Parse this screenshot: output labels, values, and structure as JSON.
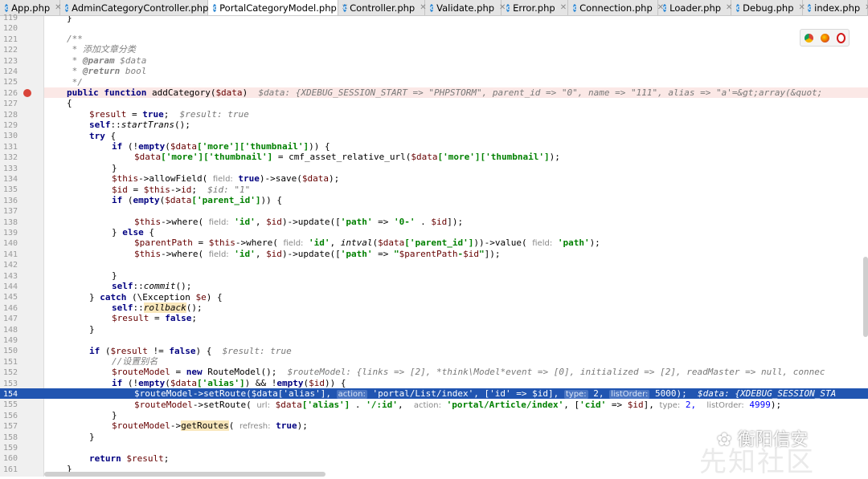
{
  "tabs": [
    {
      "label": "App.php",
      "active": false
    },
    {
      "label": "AdminCategoryController.php",
      "active": false
    },
    {
      "label": "PortalCategoryModel.php",
      "active": true
    },
    {
      "label": "Controller.php",
      "active": false
    },
    {
      "label": "Validate.php",
      "active": false
    },
    {
      "label": "Error.php",
      "active": false
    },
    {
      "label": "Connection.php",
      "active": false
    },
    {
      "label": "Loader.php",
      "active": false
    },
    {
      "label": "Debug.php",
      "active": false
    },
    {
      "label": "index.php",
      "active": false
    }
  ],
  "line_numbers": [
    "119",
    "120",
    "121",
    "122",
    "123",
    "124",
    "125",
    "126",
    "127",
    "128",
    "129",
    "130",
    "131",
    "132",
    "133",
    "134",
    "135",
    "136",
    "137",
    "138",
    "139",
    "140",
    "141",
    "142",
    "143",
    "144",
    "145",
    "146",
    "147",
    "148",
    "149",
    "150",
    "151",
    "152",
    "153",
    "154",
    "155",
    "156",
    "157",
    "158",
    "159",
    "160",
    "161"
  ],
  "code": {
    "l119": "}",
    "l121": "/**",
    "l122a": " * ",
    "l122b": "添加文章分类",
    "l123a": " * ",
    "l123b": "@param",
    "l123c": " $data",
    "l124a": " * ",
    "l124b": "@return",
    "l124c": " bool",
    "l125": " */",
    "l126a": "public function",
    "l126b": " addCategory(",
    "l126c": "$data",
    "l126d": ")",
    "l126e": "$data: {XDEBUG_SESSION_START => \"PHPSTORM\", parent_id => \"0\", name => \"111\", alias => \"a'=&gt;array(&quot;",
    "l127": "{",
    "l128a": "$result",
    "l128b": " = ",
    "l128c": "true",
    "l128d": ";",
    "l128e": "$result: true",
    "l129a": "self",
    "l129b": "::",
    "l129c": "startTrans",
    "l129d": "();",
    "l130a": "try",
    "l130b": " {",
    "l131a": "if",
    "l131b": " (!",
    "l131c": "empty",
    "l131d": "(",
    "l131e": "$data",
    "l131f": "['more']['thumbnail']",
    "l131g": ")) {",
    "l132a": "$data",
    "l132b": "['more']['thumbnail']",
    "l132c": " = cmf_asset_relative_url(",
    "l132d": "$data",
    "l132e": "['more']['thumbnail']",
    "l132f": ");",
    "l133": "}",
    "l134a": "$this",
    "l134b": "->allowField( ",
    "l134c": "field:",
    "l134d": " true",
    "l134e": ")->save(",
    "l134f": "$data",
    "l134g": ");",
    "l135a": "$id",
    "l135b": " = ",
    "l135c": "$this",
    "l135d": "->",
    "l135e": "id",
    "l135f": ";",
    "l135g": "$id: \"1\"",
    "l136a": "if",
    "l136b": " (",
    "l136c": "empty",
    "l136d": "(",
    "l136e": "$data",
    "l136f": "['parent_id']",
    "l136g": ")) {",
    "l138a": "$this",
    "l138b": "->where( ",
    "l138c": "field:",
    "l138d": " 'id'",
    "l138e": ", ",
    "l138f": "$id",
    "l138g": ")->update([",
    "l138h": "'path'",
    "l138i": " => ",
    "l138j": "'0-'",
    "l138k": " . ",
    "l138l": "$id",
    "l138m": "]);",
    "l139a": "} ",
    "l139b": "else",
    "l139c": " {",
    "l140a": "$parentPath",
    "l140b": " = ",
    "l140c": "$this",
    "l140d": "->where( ",
    "l140e": "field:",
    "l140f": " 'id'",
    "l140g": ", ",
    "l140h": "intval",
    "l140i": "(",
    "l140j": "$data",
    "l140k": "['parent_id']",
    "l140l": "))->value( ",
    "l140m": "field:",
    "l140n": " 'path'",
    "l140o": ");",
    "l141a": "$this",
    "l141b": "->where( ",
    "l141c": "field:",
    "l141d": " 'id'",
    "l141e": ", ",
    "l141f": "$id",
    "l141g": ")->update([",
    "l141h": "'path'",
    "l141i": " => ",
    "l141j": "\"",
    "l141k": "$parentPath",
    "l141l": "-",
    "l141m": "$id",
    "l141n": "\"",
    "l141o": "]);",
    "l143": "}",
    "l144a": "self",
    "l144b": "::",
    "l144c": "commit",
    "l144d": "();",
    "l145a": "} ",
    "l145b": "catch",
    "l145c": " (\\Exception ",
    "l145d": "$e",
    "l145e": ") {",
    "l146a": "self",
    "l146b": "::",
    "l146c": "rollback",
    "l146d": "();",
    "l147a": "$result",
    "l147b": " = ",
    "l147c": "false",
    "l147d": ";",
    "l148": "}",
    "l150a": "if",
    "l150b": " (",
    "l150c": "$result",
    "l150d": " != ",
    "l150e": "false",
    "l150f": ") {",
    "l150g": "$result: true",
    "l151": "//设置别名",
    "l152a": "$routeModel",
    "l152b": " = ",
    "l152c": "new",
    "l152d": " RouteModel();",
    "l152e": "$routeModel: {links => [2], *think\\Model*event => [0], initialized => [2], readMaster => null, connec",
    "l153a": "if",
    "l153b": " (!",
    "l153c": "empty",
    "l153d": "(",
    "l153e": "$data",
    "l153f": "['alias']",
    "l153g": ") && !",
    "l153h": "empty",
    "l153i": "(",
    "l153j": "$id",
    "l153k": ")) {",
    "l154a": "$routeModel->setRoute($data['alias'], ",
    "l154b": "action:",
    "l154c": " 'portal/List/index', ['id' => $id], ",
    "l154d": "type:",
    "l154e": " 2, ",
    "l154f": "listOrder:",
    "l154g": " 5000);",
    "l154h": "$data: {XDEBUG_SESSION_STA",
    "l155a": "$routeModel",
    "l155b": "->setRoute( ",
    "l155c": "url:",
    "l155d": " $data",
    "l155e": "['alias']",
    "l155f": " . ",
    "l155g": "'/:id'",
    "l155h": ",  ",
    "l155i": "action:",
    "l155j": " 'portal/Article/index'",
    "l155k": ", [",
    "l155l": "'cid'",
    "l155m": " => ",
    "l155n": "$id",
    "l155o": "], ",
    "l155p": "type:",
    "l155q": " 2,  ",
    "l155r": "listOrder:",
    "l155s": " 4999",
    "l155t": ");",
    "l156": "}",
    "l157a": "$routeModel",
    "l157b": "->",
    "l157c": "getRoutes",
    "l157d": "( ",
    "l157e": "refresh:",
    "l157f": " true",
    "l157g": ");",
    "l158": "}",
    "l160a": "return",
    "l160b": " $result",
    "l160c": ";",
    "l161": "}"
  },
  "watermark": {
    "text": "衡阳信安",
    "sub": "先知社区"
  },
  "colors": {
    "selection": "#2155b1",
    "breakpoint_row": "#fbe8e6",
    "keyword": "#000080",
    "string": "#008000",
    "variable": "#660000"
  }
}
